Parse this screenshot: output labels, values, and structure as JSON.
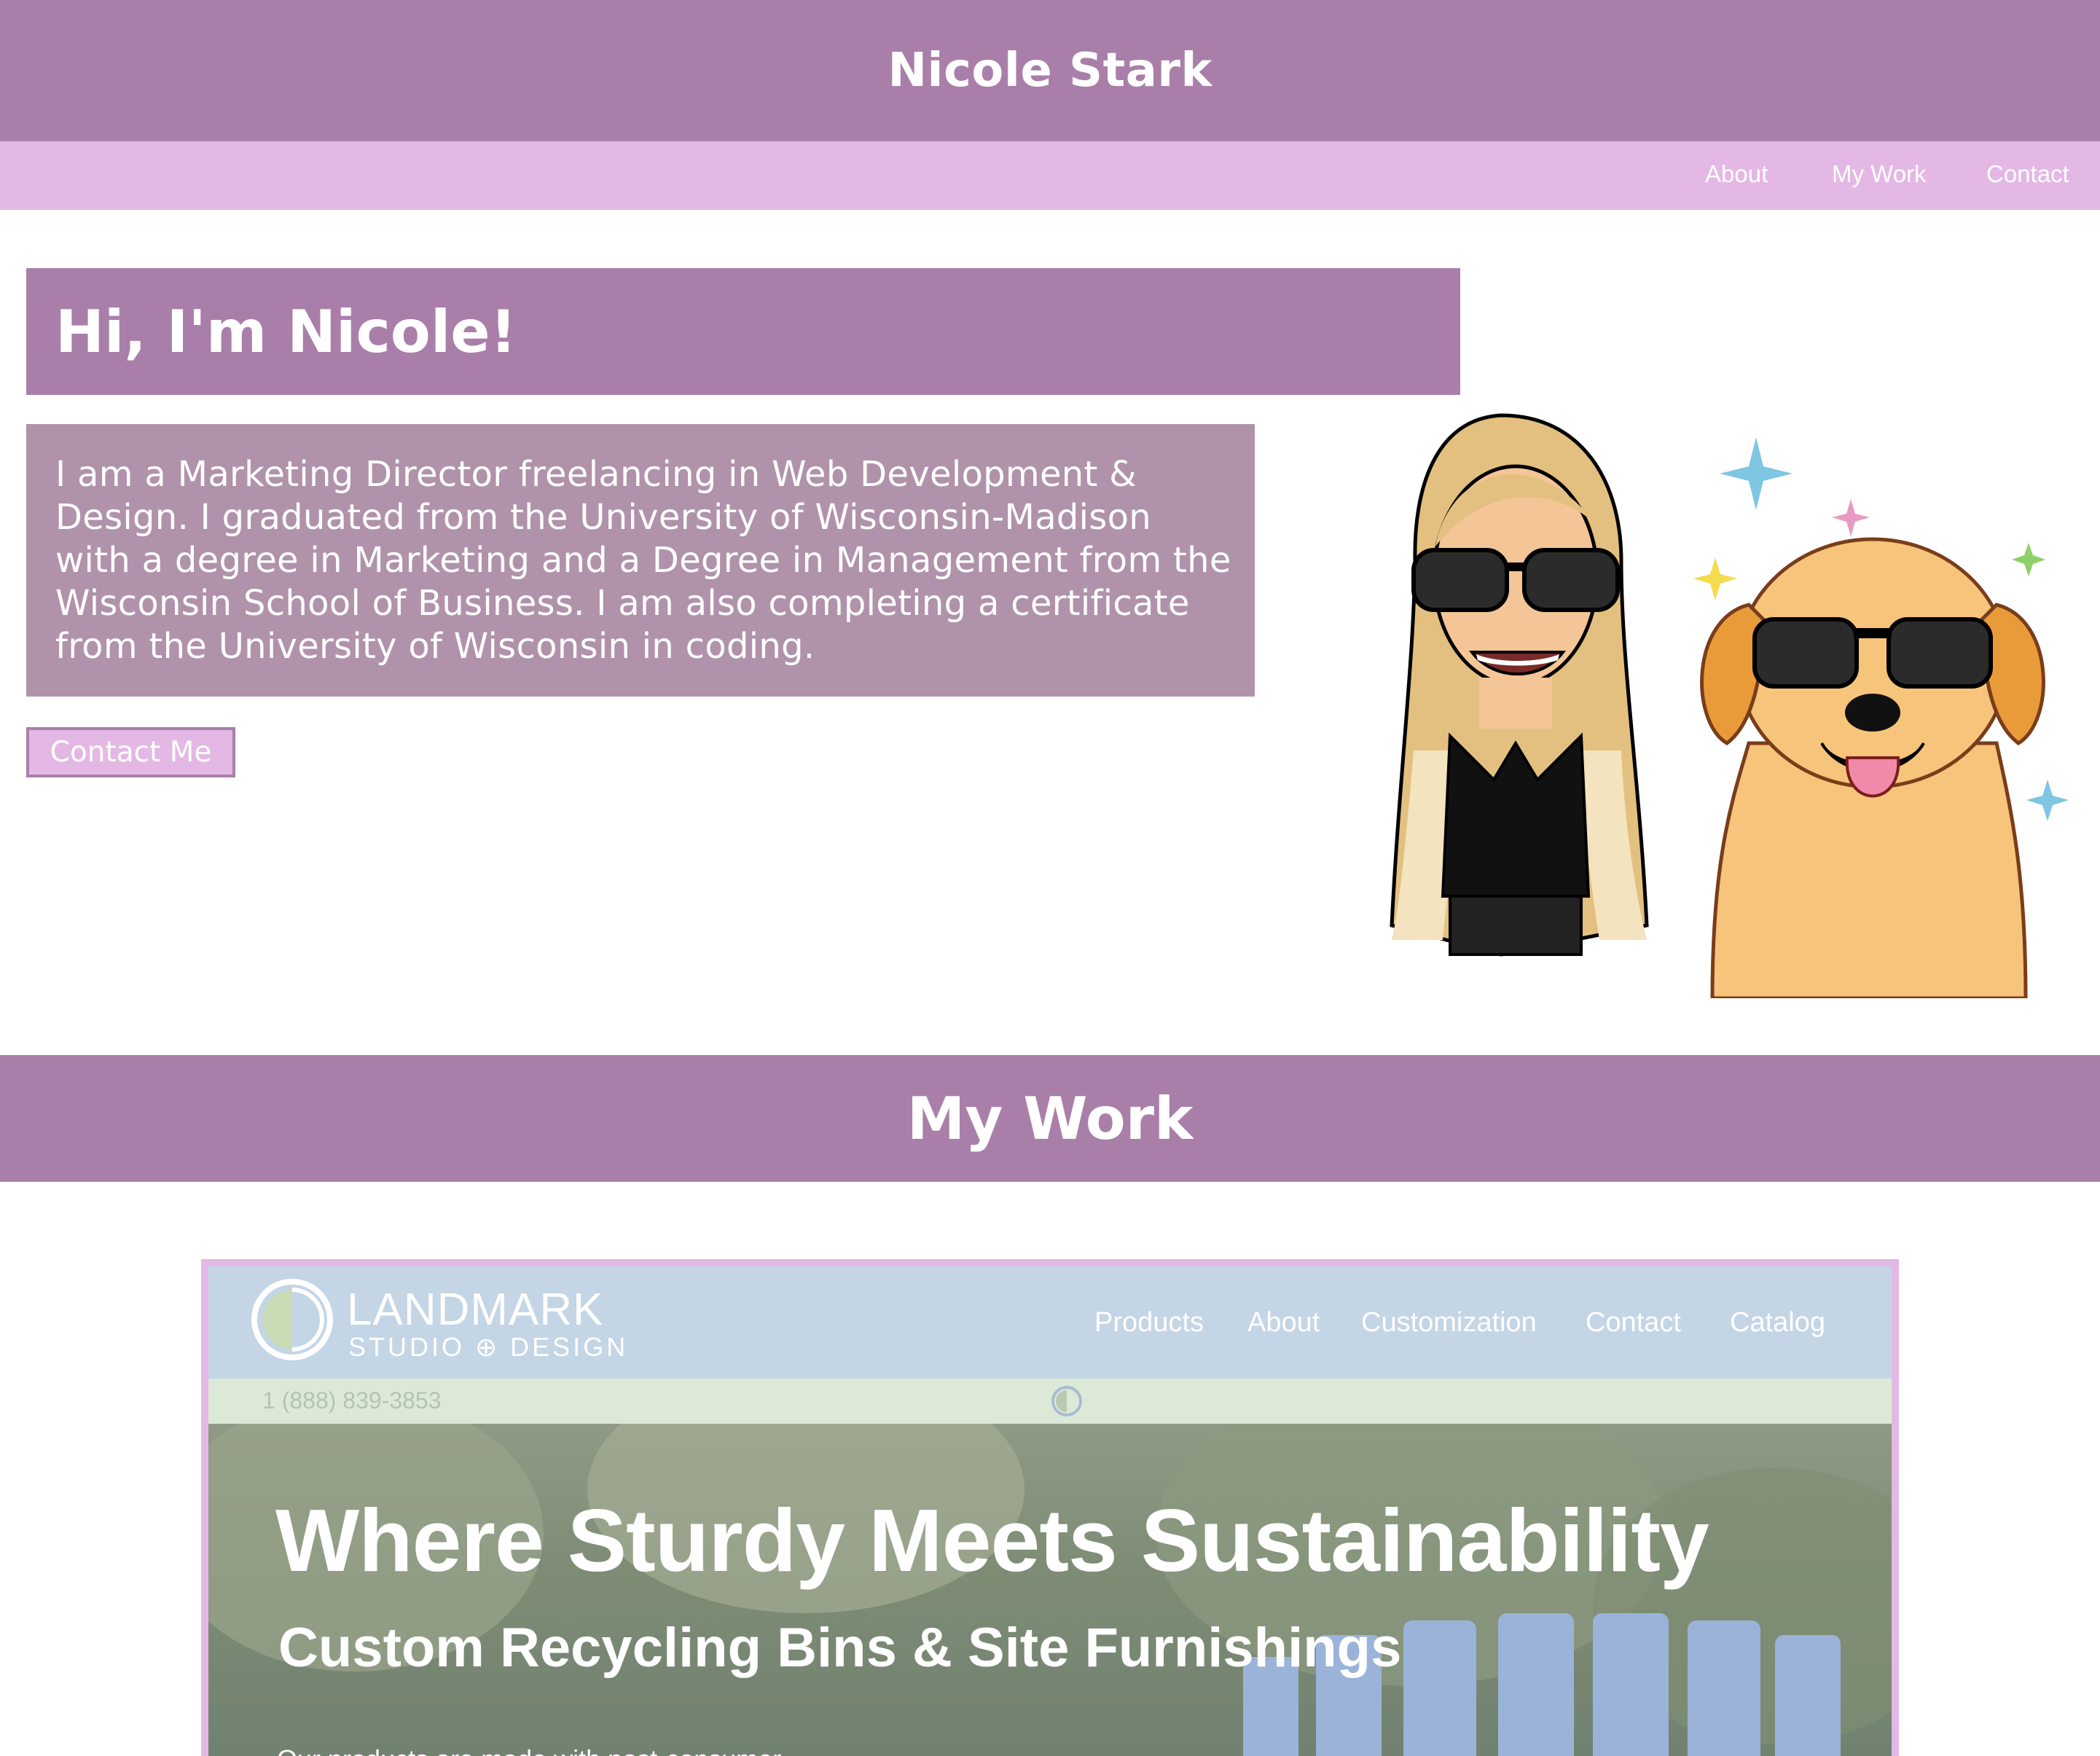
{
  "site": {
    "title": "Nicole Stark"
  },
  "nav": {
    "about": "About",
    "my_work": "My Work",
    "contact": "Contact"
  },
  "hero": {
    "heading": "Hi, I'm Nicole!",
    "bio_lines": [
      "I am a Marketing Director freelancing in Web Development &",
      "Design. I graduated from the University of Wisconsin-Madison",
      "with a degree in Marketing and a Degree in Management from the",
      "Wisconsin School of Business. I am also completing a certificate",
      "from the University of Wisconsin in coding."
    ],
    "contact_button": "Contact Me"
  },
  "work": {
    "title": "My Work",
    "project": {
      "brand": "LANDMARK",
      "brand_sub": "STUDIO ⊕ DESIGN",
      "nav": [
        "Products",
        "About",
        "Customization",
        "Contact",
        "Catalog"
      ],
      "phone": "1 (888) 839-3853",
      "headline": "Where Sturdy Meets Sustainability",
      "subhead": "Custom Recycling Bins & Site Furnishings",
      "body": "Our products are made with post-consumer"
    }
  },
  "colors": {
    "header_purple": "#a97fa9",
    "nav_pink": "#e4b8e4",
    "bio_mauve": "#b092ab",
    "text_white": "#ffffff"
  }
}
